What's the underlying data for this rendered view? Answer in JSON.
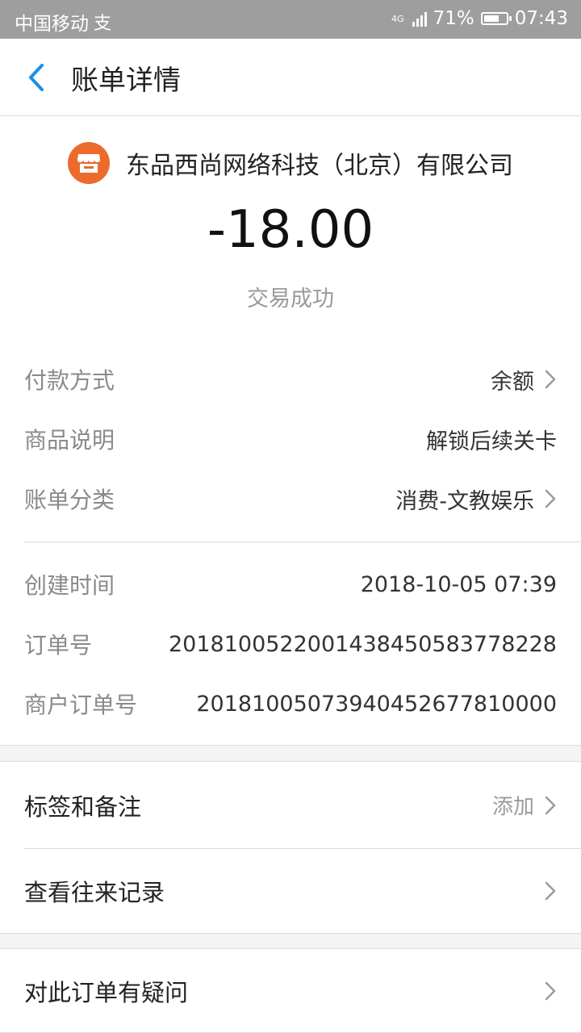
{
  "status_bar": {
    "carrier": "中国移动",
    "network": "4G",
    "battery": "71%",
    "battery_level": 0.71,
    "time": "07:43"
  },
  "header": {
    "title": "账单详情"
  },
  "merchant": {
    "name": "东品西尚网络科技（北京）有限公司",
    "icon": "shop-icon",
    "icon_color": "#ec6a2c"
  },
  "transaction": {
    "amount": "-18.00",
    "status": "交易成功"
  },
  "details": [
    {
      "label": "付款方式",
      "value": "余额"
    },
    {
      "label": "商品说明",
      "value": "解锁后续关卡"
    },
    {
      "label": "账单分类",
      "value": "消费-文教娱乐"
    }
  ],
  "order_info": [
    {
      "label": "创建时间",
      "value": "2018-10-05 07:39"
    },
    {
      "label": "订单号",
      "value": "2018100522001438450583778228"
    },
    {
      "label": "商户订单号",
      "value": "20181005073940452677810000"
    }
  ],
  "actions": {
    "tags": {
      "label": "标签和备注",
      "hint": "添加"
    },
    "history": {
      "label": "查看往来记录"
    },
    "question": {
      "label": "对此订单有疑问"
    }
  },
  "colors": {
    "accent": "#1a8ee8",
    "brand_orange": "#ec6a2c",
    "status_bar": "#9e9e9e"
  }
}
